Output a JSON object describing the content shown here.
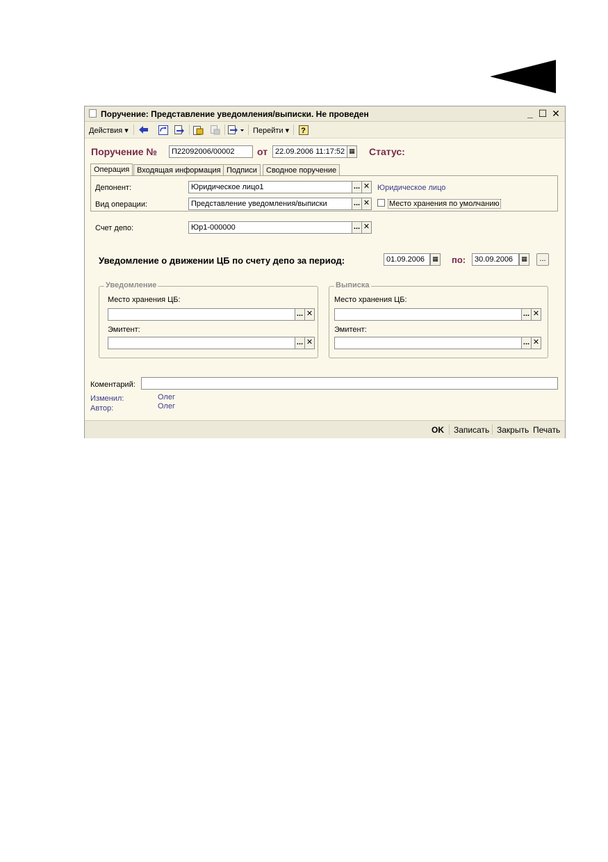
{
  "window": {
    "title": "Поручение: Представление уведомления/выписки. Не проведен",
    "controls": {
      "minimize": "_",
      "maximize": "☐",
      "close": "✕"
    }
  },
  "toolbar": {
    "actions_label": "Действия",
    "goto_label": "Перейти",
    "help_label": "?"
  },
  "header": {
    "order_label": "Поручение №",
    "order_number": "П22092006/00002",
    "from_label": "от",
    "date": "22.09.2006 11:17:52",
    "status_label": "Статус:"
  },
  "tabs": [
    {
      "label": "Операция"
    },
    {
      "label": "Входящая информация"
    },
    {
      "label": "Подписи"
    },
    {
      "label": "Сводное поручение"
    }
  ],
  "operation": {
    "deponent_label": "Депонент:",
    "deponent_value": "Юридическое лицо1",
    "deponent_type": "Юридическое лицо",
    "optype_label": "Вид операции:",
    "optype_value": "Представление уведомления/выписки",
    "default_storage_label": "Место хранения по умолчанию"
  },
  "account": {
    "label": "Счет депо:",
    "value": "Юр1-000000"
  },
  "period": {
    "title": "Уведомление о движении ЦБ по счету депо за период:",
    "from": "01.09.2006",
    "to_label": "по:",
    "to": "30.09.2006",
    "more": "..."
  },
  "notice_group": {
    "title": "Уведомление",
    "storage_label": "Место хранения ЦБ:",
    "storage_value": "",
    "issuer_label": "Эмитент:",
    "issuer_value": ""
  },
  "statement_group": {
    "title": "Выписка",
    "storage_label": "Место хранения ЦБ:",
    "storage_value": "",
    "issuer_label": "Эмитент:",
    "issuer_value": ""
  },
  "comment": {
    "label": "Коментарий:",
    "value": ""
  },
  "audit": {
    "changed_label": "Изменил:",
    "changed_value": "Олег",
    "author_label": "Автор:",
    "author_value": "Олег"
  },
  "footer": {
    "ok": "OK",
    "save": "Записать",
    "close": "Закрыть",
    "print": "Печать"
  },
  "mini": {
    "select": "...",
    "clear": "✕"
  },
  "colors": {
    "accent": "#7a2a4a",
    "link": "#3a3a8a",
    "window_bg": "#fbf8ea"
  }
}
